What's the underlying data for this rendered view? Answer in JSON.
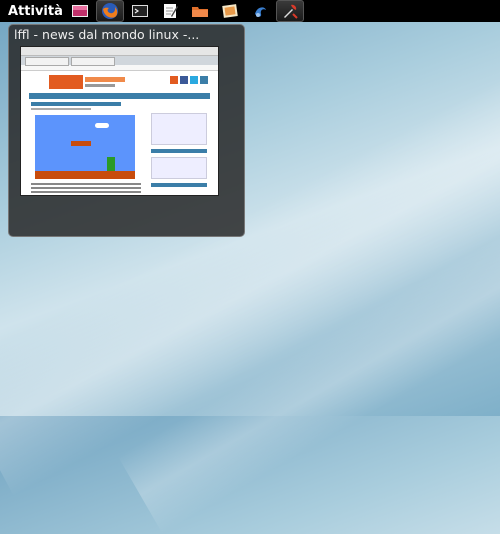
{
  "panel": {
    "activities_label": "Attività",
    "dock": [
      {
        "name": "image-viewer-icon",
        "active": false
      },
      {
        "name": "firefox-icon",
        "active": true
      },
      {
        "name": "terminal-icon",
        "active": false
      },
      {
        "name": "text-editor-icon",
        "active": false
      },
      {
        "name": "folder-icon",
        "active": false
      },
      {
        "name": "photos-icon",
        "active": false
      },
      {
        "name": "network-icon",
        "active": false
      },
      {
        "name": "tools-icon",
        "active": false
      }
    ]
  },
  "window_preview": {
    "title": "lffl - news dal mondo linux -..."
  },
  "colors": {
    "panel_bg": "#000000",
    "desktop_top": "#6fa2c0",
    "desktop_mid": "#cfe3ec"
  }
}
